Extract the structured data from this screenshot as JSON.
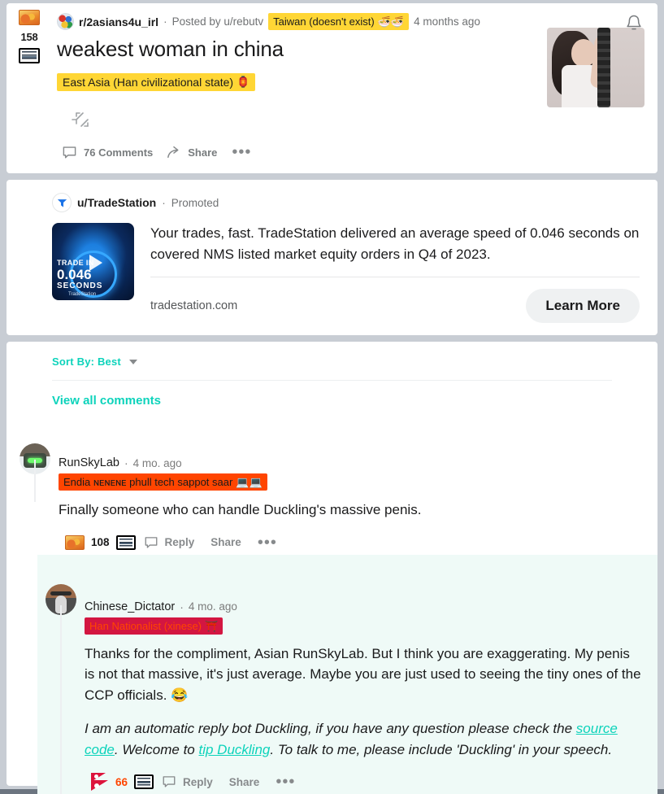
{
  "post": {
    "score": "158",
    "upvote_icon": "instant-noodles-emoji-upvote-icon",
    "downvote_icon": "newspaper-emoji-downvote-icon",
    "subreddit": "r/2asians4u_irl",
    "separator": "·",
    "posted_by": "Posted by u/rebutv",
    "author_flair": "Taiwan (doesn't exist)",
    "author_flair_emoji": "🍜🍜",
    "timestamp": "4 months ago",
    "title": "weakest woman in china",
    "post_flair": "East Asia (Han civilizational state)",
    "post_flair_emoji": "🏮",
    "comments_label": "76 Comments",
    "share_label": "Share",
    "more_label": "•••",
    "bell_icon": "notification-bell-icon",
    "expand_icon": "expand-arrows-icon",
    "thumbnail_alt": "post-thumbnail-woman-with-rifle"
  },
  "ad": {
    "username": "u/TradeStation",
    "separator": "·",
    "promoted_label": "Promoted",
    "body": "Your trades, fast. TradeStation delivered an average speed of 0.046 seconds on covered NMS listed market equity orders in Q4 of 2023.",
    "url": "tradestation.com",
    "cta_label": "Learn More",
    "thumb_line1": "TRADE IN",
    "thumb_line2": "0.046",
    "thumb_line3": "SECONDS",
    "thumb_brand": "TradeStation"
  },
  "comments_header": {
    "sort_label": "Sort By: Best",
    "view_all_label": "View all comments"
  },
  "comments": [
    {
      "username": "RunSkyLab",
      "separator": "·",
      "timestamp": "4 mo. ago",
      "flair": "Endia ɴᴇɴᴇɴᴇ phull tech sappot saar",
      "flair_emoji": "💻💻",
      "text": "Finally someone who can handle Duckling's massive penis.",
      "score": "108",
      "upvote_icon": "instant-noodles-emoji-upvote-icon",
      "downvote_icon": "newspaper-emoji-downvote-icon",
      "reply_label": "Reply",
      "share_label": "Share",
      "more_label": "•••"
    },
    {
      "username": "Chinese_Dictator",
      "separator": "·",
      "timestamp": "4 mo. ago",
      "flair": "Han Nationalist (xinese)",
      "flair_emoji": "⛩️",
      "text": "Thanks for the compliment, Asian RunSkyLab. But I think you are exaggerating. My penis is not that massive, it's just average. Maybe you are just used to seeing the tiny ones of the CCP officials. 😂",
      "bot_text_1": "I am an automatic reply bot Duckling, if you have any question please check the ",
      "bot_link_1": "source code",
      "bot_text_2": ". Welcome to ",
      "bot_link_2": "tip Duckling",
      "bot_text_3": ". To talk to me, please include 'Duckling' in your speech.",
      "score": "66",
      "upvote_icon": "nepal-flag-emoji-upvote-icon",
      "downvote_icon": "newspaper-emoji-downvote-icon",
      "reply_label": "Reply",
      "share_label": "Share",
      "more_label": "•••"
    }
  ],
  "colors": {
    "accent_teal": "#0dd3bb",
    "upvote_orange": "#ff4500",
    "flair_yellow": "#ffd635",
    "flair_orange": "#ff4500",
    "flair_red": "#d31641",
    "page_bg": "#c8cdd4",
    "nested_bg": "#effaf7"
  }
}
